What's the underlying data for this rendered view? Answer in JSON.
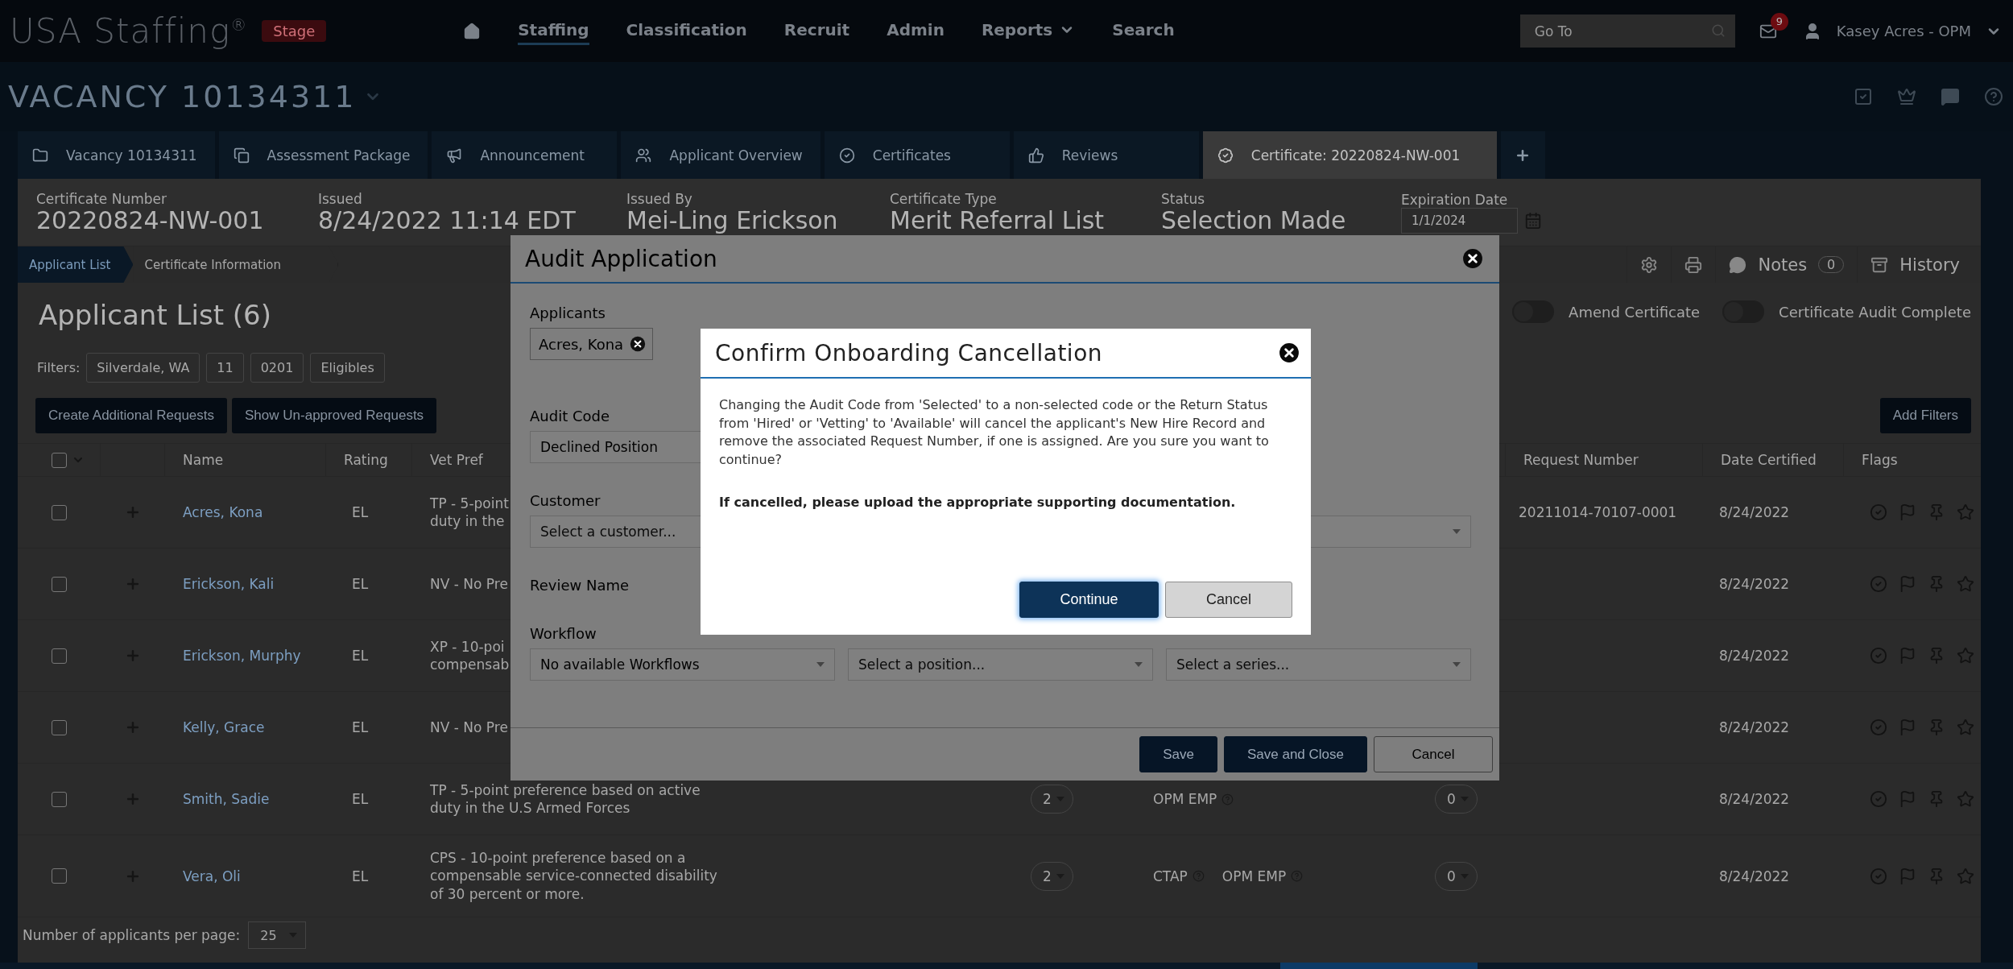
{
  "nav": {
    "logo": "USA Staffing",
    "logo_mark": "®",
    "env_badge": "Stage",
    "links": [
      {
        "label": "Staffing",
        "selected": true,
        "has_menu": false
      },
      {
        "label": "Classification",
        "selected": false,
        "has_menu": false
      },
      {
        "label": "Recruit",
        "selected": false,
        "has_menu": false
      },
      {
        "label": "Admin",
        "selected": false,
        "has_menu": false
      },
      {
        "label": "Reports",
        "selected": false,
        "has_menu": true
      },
      {
        "label": "Search",
        "selected": false,
        "has_menu": false
      }
    ],
    "goto_placeholder": "Go To",
    "mail_count": "9",
    "user": "Kasey Acres - OPM"
  },
  "vacancy": {
    "title": "VACANCY 10134311"
  },
  "tabs": [
    {
      "label": "Vacancy 10134311",
      "kind": "folder",
      "selected": false
    },
    {
      "label": "Assessment Package",
      "kind": "copy",
      "selected": false
    },
    {
      "label": "Announcement",
      "kind": "megaphone",
      "selected": false
    },
    {
      "label": "Applicant Overview",
      "kind": "users",
      "selected": false
    },
    {
      "label": "Certificates",
      "kind": "check",
      "selected": false
    },
    {
      "label": "Reviews",
      "kind": "thumb",
      "selected": false
    },
    {
      "label": "Certificate: 20220824-NW-001",
      "kind": "badge",
      "selected": true
    }
  ],
  "certificate": {
    "fields": [
      {
        "label": "Certificate Number",
        "value": "20220824-NW-001"
      },
      {
        "label": "Issued",
        "value": "8/24/2022 11:14 EDT"
      },
      {
        "label": "Issued By",
        "value": "Mei-Ling Erickson"
      },
      {
        "label": "Certificate Type",
        "value": "Merit Referral List"
      },
      {
        "label": "Status",
        "value": "Selection Made"
      }
    ],
    "expiration": {
      "label": "Expiration Date",
      "value": "1/1/2024"
    }
  },
  "subnav": {
    "crumbs": [
      {
        "label": "Applicant List",
        "selected": true
      },
      {
        "label": "Certificate Information",
        "selected": false
      }
    ],
    "notes_label": "Notes",
    "notes_count": "0",
    "history_label": "History"
  },
  "applicant_list": {
    "title": "Applicant List (6)",
    "toggles": [
      {
        "label": "Amend Certificate",
        "on": false
      },
      {
        "label": "Certificate Audit Complete",
        "on": false
      }
    ],
    "filters_label": "Filters:",
    "filters": [
      "Silverdale, WA",
      "11",
      "0201",
      "Eligibles"
    ],
    "actions": [
      "Create Additional Requests",
      "Show Un-approved Requests"
    ],
    "add_filters": "Add Filters"
  },
  "table": {
    "header_checked": false,
    "columns": {
      "name": "Name",
      "rating": "Rating",
      "vet_pref": "Vet Pref",
      "request_number": "Request Number",
      "date_certified": "Date Certified",
      "flags": "Flags"
    },
    "rows": [
      {
        "checked": false,
        "name": "Acres, Kona",
        "rating": "EL",
        "vet_pref": [
          "TP - 5-point",
          "duty in the"
        ],
        "request_number": "20211014-70107-0001",
        "date_certified": "8/24/2022"
      },
      {
        "checked": false,
        "name": "Erickson, Kali",
        "rating": "EL",
        "vet_pref": [
          "NV - No Pre"
        ],
        "date_certified": "8/24/2022"
      },
      {
        "checked": false,
        "name": "Erickson, Murphy",
        "rating": "EL",
        "vet_pref": [
          "XP - 10-poi",
          "compensab"
        ],
        "date_certified": "8/24/2022"
      },
      {
        "checked": false,
        "name": "Kelly, Grace",
        "rating": "EL",
        "vet_pref": [
          "NV - No Pre"
        ],
        "date_certified": "8/24/2022"
      },
      {
        "checked": false,
        "name": "Smith, Sadie",
        "rating": "EL",
        "vet_pref": [
          "TP - 5-point preference based on active",
          "duty in the U.S Armed Forces"
        ],
        "points": "2",
        "preferences": [
          "OPM EMP"
        ],
        "count": "0",
        "date_certified": "8/24/2022"
      },
      {
        "checked": false,
        "name": "Vera, Oli",
        "rating": "EL",
        "vet_pref": [
          "CPS - 10-point preference based on a",
          "compensable service-connected disability",
          "of 30 percent or more."
        ],
        "points": "2",
        "preferences": [
          "CTAP",
          "OPM EMP"
        ],
        "count": "0",
        "date_certified": "8/24/2022"
      }
    ]
  },
  "per_page": {
    "label": "Number of applicants per page:",
    "value": "25"
  },
  "audit_modal": {
    "title": "Audit Application",
    "applicants_label": "Applicants",
    "applicant_chip": "Acres, Kona",
    "audit_code_label": "Audit Code",
    "audit_code": "Declined Position",
    "customer_label": "Customer",
    "customer_placeholder": "Select a customer...",
    "review_name_label": "Review Name",
    "workflow_label": "Workflow",
    "workflow": "No available Workflows",
    "position_placeholder": "Select a position...",
    "series_placeholder": "Select a series...",
    "buttons": [
      {
        "label": "Save",
        "kind": "primary"
      },
      {
        "label": "Save and Close",
        "kind": "primary"
      },
      {
        "label": "Cancel",
        "kind": "secondary"
      }
    ]
  },
  "confirm_modal": {
    "title": "Confirm Onboarding Cancellation",
    "message": "Changing the Audit Code from 'Selected' to a non-selected code or the Return Status from 'Hired' or 'Vetting' to 'Available' will cancel the applicant's New Hire Record and remove the associated Request Number, if one is assigned. Are you sure you want to continue?",
    "note": "If cancelled, please upload the appropriate supporting documentation.",
    "buttons": [
      {
        "label": "Continue",
        "kind": "primary"
      },
      {
        "label": "Cancel",
        "kind": "secondary"
      }
    ]
  }
}
